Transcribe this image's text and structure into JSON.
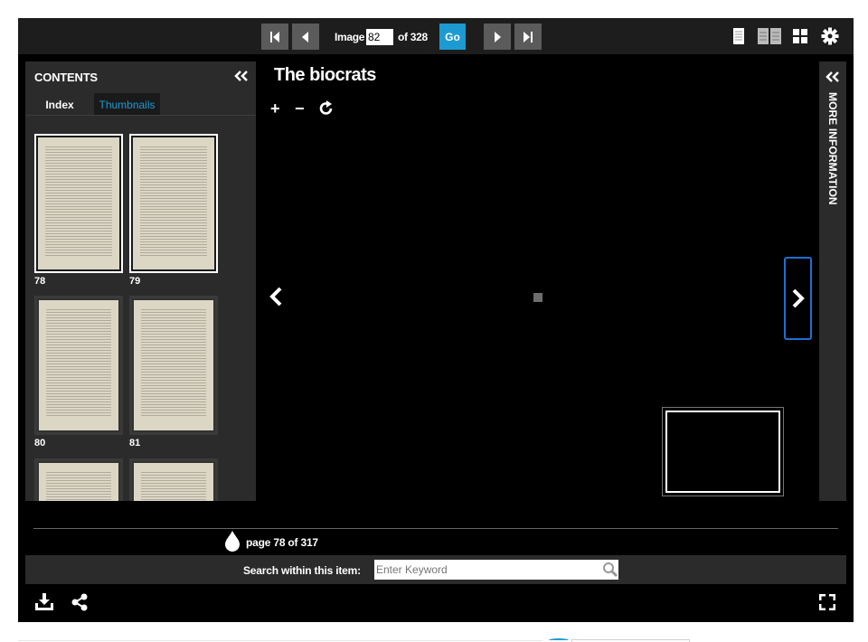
{
  "toolbar": {
    "image_label": "Image",
    "image_value": "82",
    "of_label": "of 328",
    "go_label": "Go",
    "icons": [
      "first-page-icon",
      "previous-page-icon",
      "next-page-icon",
      "last-page-icon",
      "one-page-view-icon",
      "two-page-view-icon",
      "gallery-view-icon",
      "gear-icon"
    ]
  },
  "contents": {
    "title": "CONTENTS",
    "tabs": [
      {
        "label": "Index",
        "active": false
      },
      {
        "label": "Thumbnails",
        "active": true
      }
    ],
    "thumbnails": [
      {
        "page": "78",
        "selected": true
      },
      {
        "page": "79",
        "selected": true
      },
      {
        "page": "80",
        "selected": false
      },
      {
        "page": "81",
        "selected": false
      }
    ]
  },
  "main": {
    "title": "The biocrats",
    "tools": {
      "zoom_in": "+",
      "zoom_out": "−",
      "rotate_icon": "rotate-icon"
    }
  },
  "info_panel": {
    "label": "MORE INFORMATION"
  },
  "footer": {
    "page_text": "page 78 of 317",
    "search_label": "Search within this item:",
    "search_placeholder": "Enter Keyword"
  },
  "colors": {
    "accent": "#1d9ad1",
    "focus_border": "#1d6fd1",
    "panel": "#2b2b2b",
    "toolbar": "#1d1d1d"
  }
}
